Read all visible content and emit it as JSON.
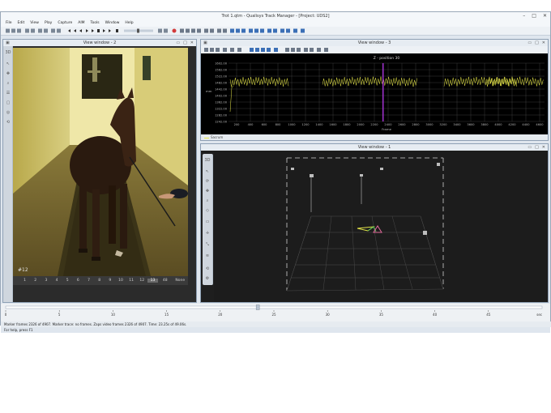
{
  "window": {
    "title": "Trot 1.qtm - Qualisys Track Manager - [Project: UDS2]",
    "minimize": "–",
    "maximize": "□",
    "close": "✕"
  },
  "menu": [
    "File",
    "Edit",
    "View",
    "Play",
    "Capture",
    "AIM",
    "Tools",
    "Window",
    "Help"
  ],
  "view2": {
    "title": "View window - 2",
    "frame_label": "#12",
    "frames": [
      "1",
      "2",
      "3",
      "4",
      "5",
      "6",
      "7",
      "8",
      "9",
      "10",
      "11",
      "12",
      "13",
      "48",
      "None"
    ],
    "selected_frame": "13",
    "sidebar_label": "3D"
  },
  "view3": {
    "title": "View window - 3",
    "plot_title": "Z - position 30",
    "xlabel": "Frame",
    "ylabel": "mm",
    "legend": "Sacrum",
    "yticks": [
      "1602.00",
      "1562.00",
      "1522.00",
      "1482.00",
      "1442.00",
      "1402.00",
      "1362.00",
      "1322.00",
      "1282.00",
      "1242.00"
    ],
    "xticks": [
      "200",
      "400",
      "600",
      "800",
      "1000",
      "1200",
      "1400",
      "1600",
      "1800",
      "2000",
      "2200",
      "2400",
      "2600",
      "2800",
      "3000",
      "3200",
      "3400",
      "3600",
      "3800",
      "4000",
      "4200",
      "4400",
      "4600"
    ]
  },
  "view1": {
    "title": "View window - 1",
    "sidebar_label": "3D"
  },
  "timeline": {
    "ticks": [
      "0",
      "5",
      "10",
      "15",
      "20",
      "25",
      "30",
      "35",
      "40",
      "45"
    ],
    "unit": "sec",
    "position": 0.47
  },
  "status": {
    "info": "Marker frames 2326 of 4907. Marker trace: no frames. Zaps video frames 2326 of 4907. Time: 23.25s of 49.06s.",
    "help": "For help, press F1"
  },
  "colors": {
    "trace": "#e8e84a",
    "marker_line": "#9b30c8",
    "accent": "#3b6fb6"
  }
}
